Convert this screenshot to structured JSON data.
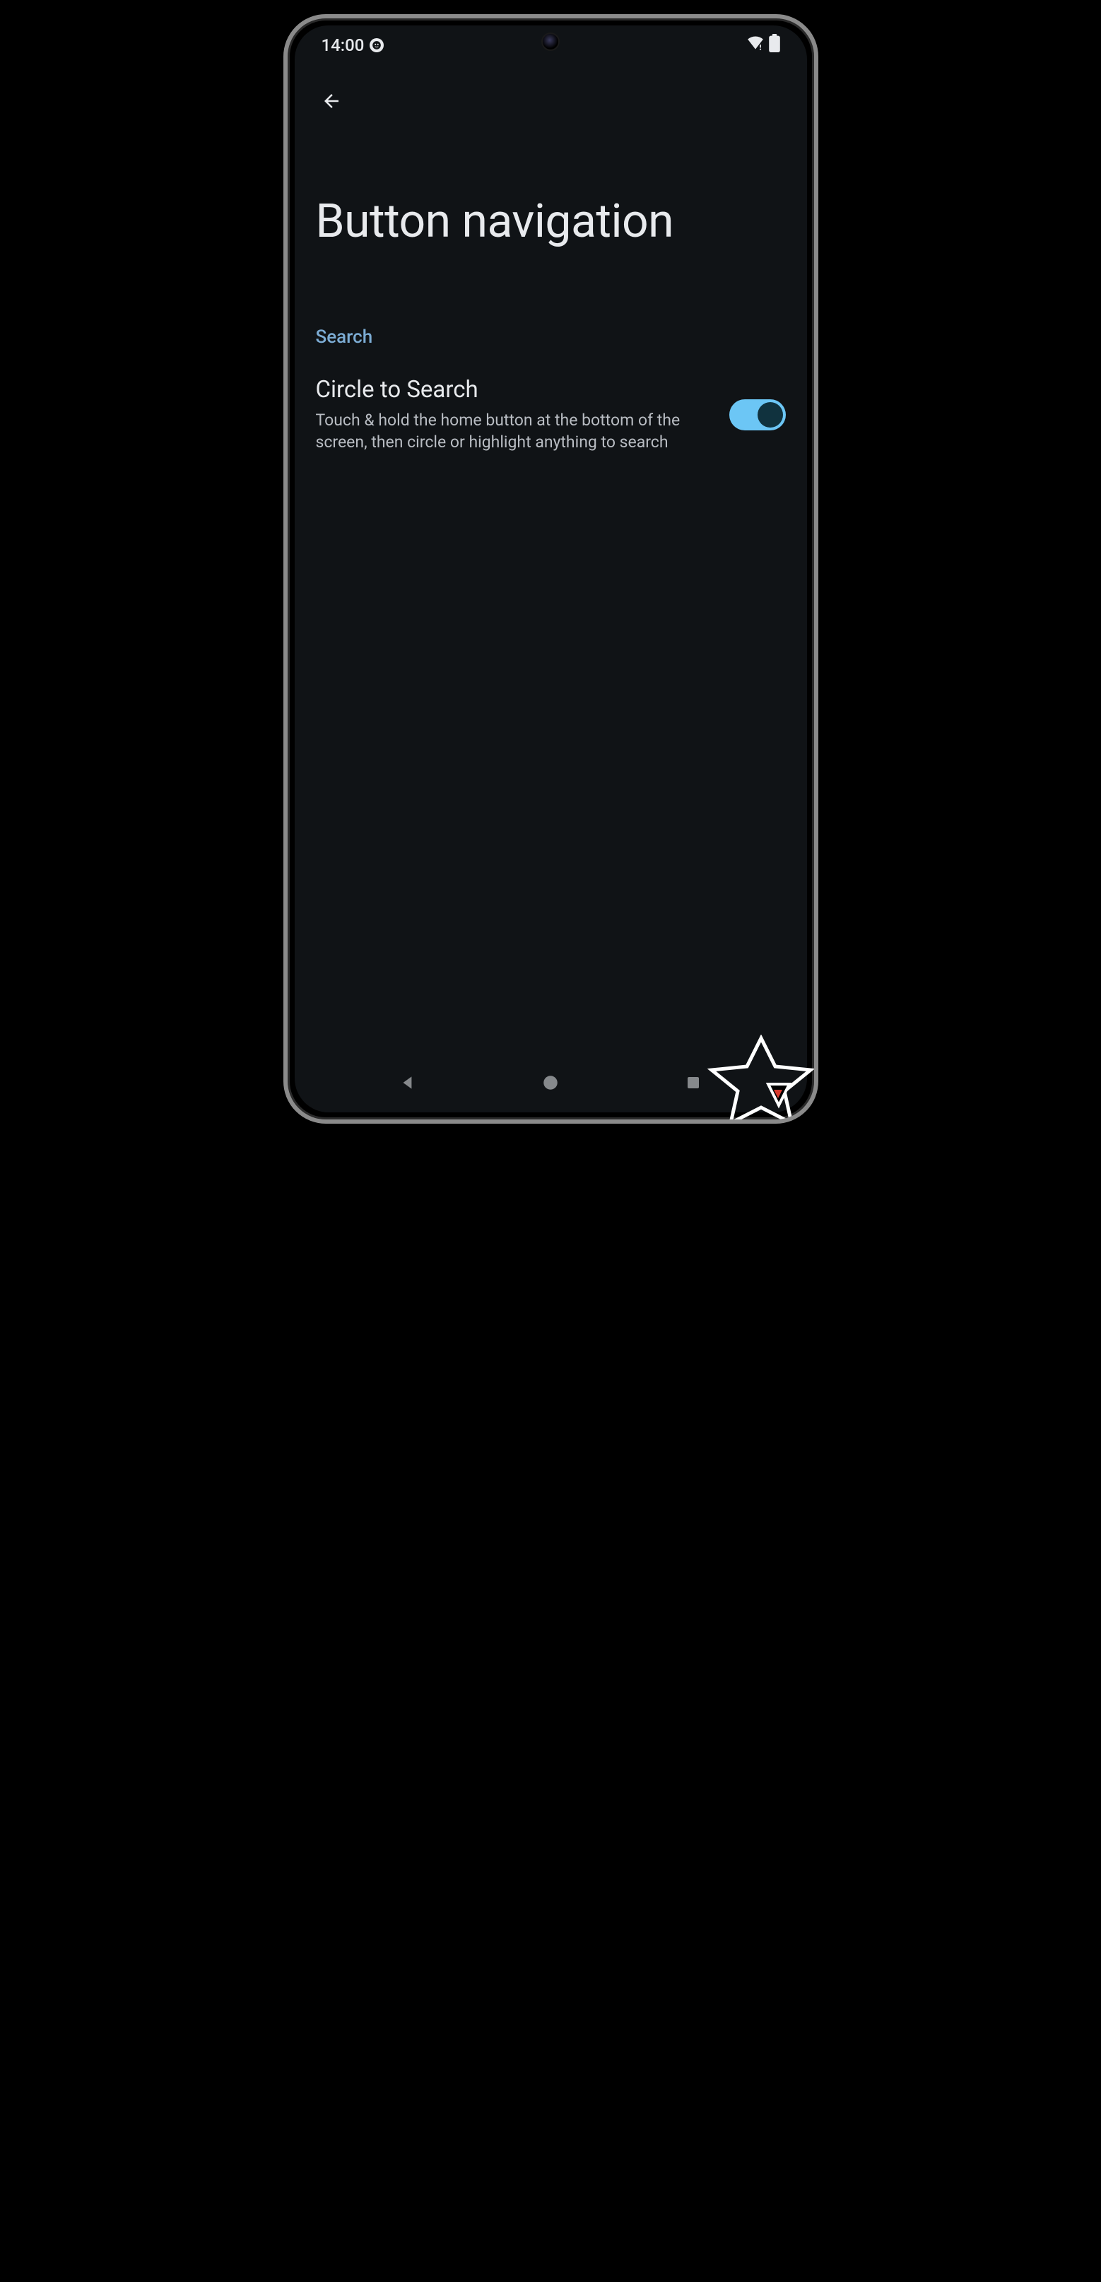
{
  "status": {
    "time": "14:00"
  },
  "page": {
    "title": "Button navigation"
  },
  "section": {
    "header": "Search"
  },
  "setting": {
    "title": "Circle to Search",
    "description": "Touch & hold the home button at the bottom of the screen, then circle or highlight anything to search",
    "enabled": true
  },
  "colors": {
    "accent": "#7cacd4",
    "toggle_on": "#6cc6f5",
    "background": "#101316",
    "text_primary": "#e8eaed",
    "text_secondary": "#b8bcc2"
  }
}
